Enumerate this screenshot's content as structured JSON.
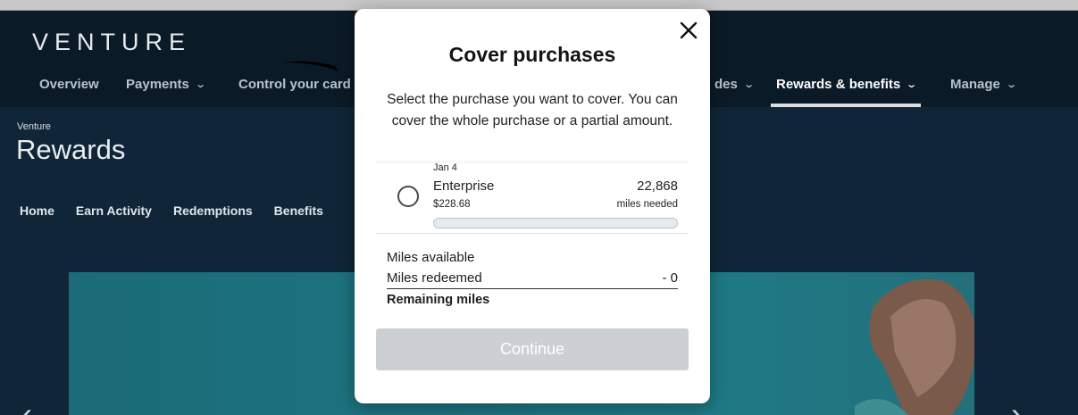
{
  "header": {
    "logo": "VENTURE",
    "nav": [
      {
        "label": "Overview"
      },
      {
        "label": "Payments"
      },
      {
        "label": "Control your card"
      },
      {
        "label": "des"
      },
      {
        "label": "Rewards & benefits"
      },
      {
        "label": "Manage"
      }
    ]
  },
  "page": {
    "breadcrumb": "Venture",
    "title": "Rewards",
    "subnav": [
      "Home",
      "Earn Activity",
      "Redemptions",
      "Benefits"
    ]
  },
  "modal": {
    "title": "Cover purchases",
    "description": "Select the purchase you want to cover. You can cover the whole purchase or a partial amount.",
    "purchase": {
      "date": "Jan 4",
      "merchant": "Enterprise",
      "amount": "$228.68",
      "miles": "22,868",
      "miles_label": "miles needed",
      "progress_fraction": 0
    },
    "summary": {
      "available_label": "Miles available",
      "available_value": "",
      "redeemed_label": "Miles redeemed",
      "redeemed_value": "- 0",
      "remaining_label": "Remaining miles",
      "remaining_value": ""
    },
    "continue_label": "Continue"
  },
  "icons": {
    "close": "close-icon",
    "chevron": "chevron-down-icon",
    "left": "chevron-left-icon",
    "right": "chevron-right-icon"
  },
  "colors": {
    "header_bg": "#0b1a27",
    "content_bg": "#102638",
    "button_disabled": "#ccd0d4"
  }
}
